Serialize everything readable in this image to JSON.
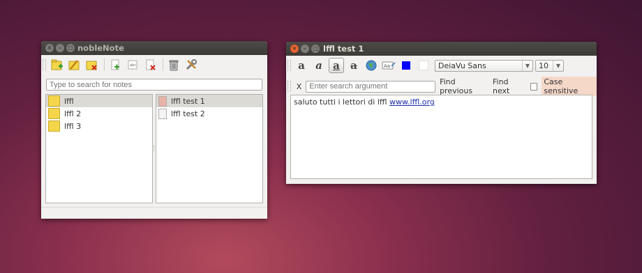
{
  "desktop": {
    "background_colors": [
      "#3f1533",
      "#8a2f4e",
      "#b24a5c"
    ]
  },
  "noblenote": {
    "title": "nobleNote",
    "toolbar_icons": [
      "new-folder-icon",
      "rename-folder-icon",
      "delete-folder-icon",
      "new-note-icon",
      "rename-note-icon",
      "delete-note-icon",
      "trash-icon",
      "settings-icon"
    ],
    "search": {
      "placeholder": "Type to search for notes"
    },
    "folders": [
      {
        "label": "lffl",
        "selected": true
      },
      {
        "label": "lffl 2",
        "selected": false
      },
      {
        "label": "lffl 3",
        "selected": false
      }
    ],
    "notes": [
      {
        "label": "lffl test 1",
        "selected": true
      },
      {
        "label": "lffl test 2",
        "selected": false
      }
    ]
  },
  "editor": {
    "title": "lffl test 1",
    "format_icons": [
      "bold-icon",
      "italic-icon",
      "underline-icon",
      "strikethrough-icon",
      "insert-link-icon",
      "spell-check-icon",
      "text-color-icon",
      "background-color-icon"
    ],
    "text_color": "#0000ff",
    "background_color": "#ffffff",
    "font": {
      "family": "DeiaVu Sans",
      "size": "10"
    },
    "find": {
      "close_label": "X",
      "placeholder": "Enter search argument",
      "find_previous": "Find previous",
      "find_next": "Find next",
      "case_sensitive": "Case sensitive"
    },
    "content": {
      "text": "saluto tutti i lettori di lffl",
      "link": "www.lffl.org"
    }
  }
}
